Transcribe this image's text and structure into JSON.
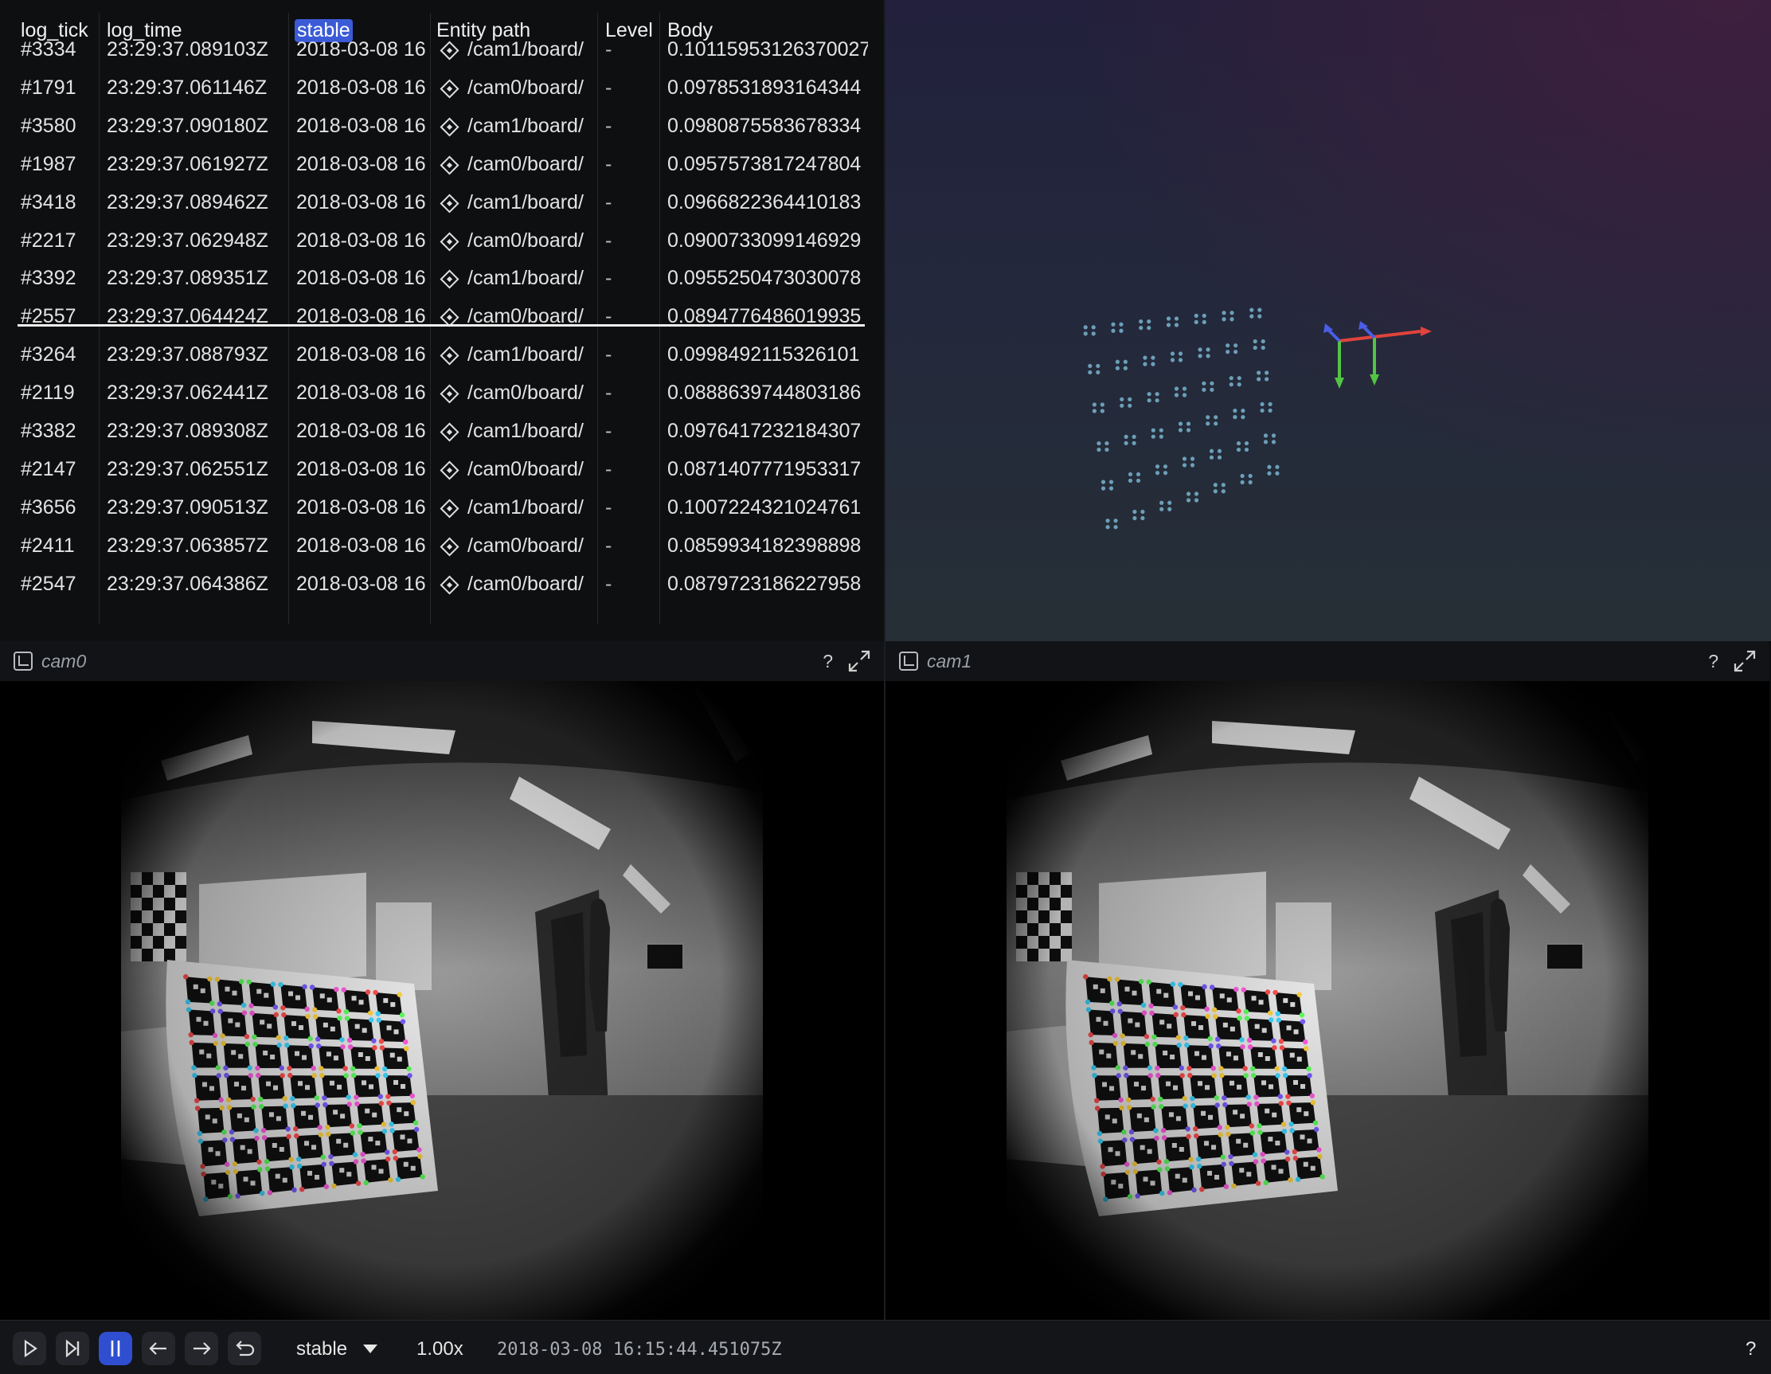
{
  "table": {
    "headers": [
      "log_tick",
      "log_time",
      "stable",
      "Entity path",
      "Level",
      "Body"
    ],
    "highlighted_header": "stable",
    "rows": [
      {
        "tick": "#3334",
        "time": "23:29:37.089103Z",
        "stable": "2018-03-08 16",
        "entity": "/cam1/board/",
        "level": "-",
        "body": "0.10115953126370027"
      },
      {
        "tick": "#1791",
        "time": "23:29:37.061146Z",
        "stable": "2018-03-08 16",
        "entity": "/cam0/board/",
        "level": "-",
        "body": "0.0978531893164344"
      },
      {
        "tick": "#3580",
        "time": "23:29:37.090180Z",
        "stable": "2018-03-08 16",
        "entity": "/cam1/board/",
        "level": "-",
        "body": "0.0980875583678334"
      },
      {
        "tick": "#1987",
        "time": "23:29:37.061927Z",
        "stable": "2018-03-08 16",
        "entity": "/cam0/board/",
        "level": "-",
        "body": "0.0957573817247804"
      },
      {
        "tick": "#3418",
        "time": "23:29:37.089462Z",
        "stable": "2018-03-08 16",
        "entity": "/cam1/board/",
        "level": "-",
        "body": "0.0966822364410183"
      },
      {
        "tick": "#2217",
        "time": "23:29:37.062948Z",
        "stable": "2018-03-08 16",
        "entity": "/cam0/board/",
        "level": "-",
        "body": "0.0900733099146929"
      },
      {
        "tick": "#3392",
        "time": "23:29:37.089351Z",
        "stable": "2018-03-08 16",
        "entity": "/cam1/board/",
        "level": "-",
        "body": "0.0955250473030078"
      },
      {
        "tick": "#2557",
        "time": "23:29:37.064424Z",
        "stable": "2018-03-08 16",
        "entity": "/cam0/board/",
        "level": "-",
        "body": "0.0894776486019935"
      },
      {
        "tick": "#3264",
        "time": "23:29:37.088793Z",
        "stable": "2018-03-08 16",
        "entity": "/cam1/board/",
        "level": "-",
        "body": "0.0998492115326101"
      },
      {
        "tick": "#2119",
        "time": "23:29:37.062441Z",
        "stable": "2018-03-08 16",
        "entity": "/cam0/board/",
        "level": "-",
        "body": "0.0888639744803186"
      },
      {
        "tick": "#3382",
        "time": "23:29:37.089308Z",
        "stable": "2018-03-08 16",
        "entity": "/cam1/board/",
        "level": "-",
        "body": "0.0976417232184307"
      },
      {
        "tick": "#2147",
        "time": "23:29:37.062551Z",
        "stable": "2018-03-08 16",
        "entity": "/cam0/board/",
        "level": "-",
        "body": "0.0871407771953317"
      },
      {
        "tick": "#3656",
        "time": "23:29:37.090513Z",
        "stable": "2018-03-08 16",
        "entity": "/cam1/board/",
        "level": "-",
        "body": "0.1007224321024761"
      },
      {
        "tick": "#2411",
        "time": "23:29:37.063857Z",
        "stable": "2018-03-08 16",
        "entity": "/cam0/board/",
        "level": "-",
        "body": "0.0859934182398898"
      },
      {
        "tick": "#2547",
        "time": "23:29:37.064386Z",
        "stable": "2018-03-08 16",
        "entity": "/cam0/board/",
        "level": "-",
        "body": "0.0879723186227958"
      }
    ]
  },
  "views": {
    "cam0": {
      "title": "cam0",
      "help": "?"
    },
    "cam1": {
      "title": "cam1",
      "help": "?"
    }
  },
  "timeline": {
    "timeline_name": "stable",
    "speed": "1.00x",
    "current_time": "2018-03-08 16:15:44.451075Z",
    "help": "?"
  },
  "colors": {
    "accent": "#2f4fd0",
    "axis_x": "#e0443c",
    "axis_y": "#52c444",
    "axis_z": "#4a5de8",
    "point": "#6c9fb8"
  },
  "icons": [
    "play-icon",
    "step-forward-icon",
    "pause-icon",
    "arrow-left-icon",
    "arrow-right-icon",
    "loop-icon",
    "chevron-down-icon",
    "expand-icon",
    "view-icon",
    "entity-icon"
  ]
}
